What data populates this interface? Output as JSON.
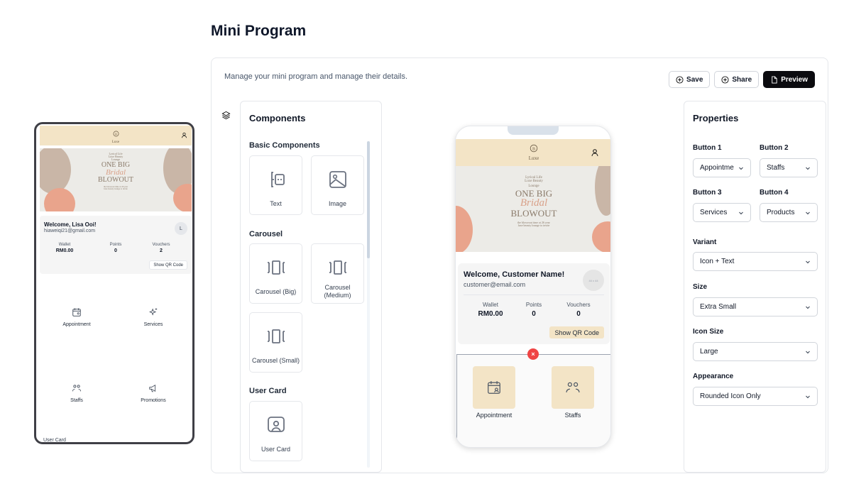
{
  "page": {
    "title": "Mini Program",
    "subtitle": "Manage your mini program and manage their details."
  },
  "toolbar": {
    "save_label": "Save",
    "share_label": "Share",
    "preview_label": "Preview"
  },
  "components": {
    "title": "Components",
    "sections": {
      "basic": "Basic Components",
      "carousel": "Carousel",
      "user_card": "User Card"
    },
    "tiles": {
      "text": "Text",
      "image": "Image",
      "carousel_big": "Carousel (Big)",
      "carousel_medium": "Carousel (Medium)",
      "carousel_small": "Carousel (Small)",
      "user_card": "User Card"
    }
  },
  "preview_phone": {
    "brand": "Luxe",
    "banner": {
      "line1": "Lyrical Life",
      "line2": "Luxe Beauty",
      "line3": "Lounge",
      "headline1": "ONE BIG",
      "script": "Bridal",
      "headline2": "BLOWOUT",
      "fine1": "the bloweout time at 26 year",
      "fine2": "luxe beauty lounge to invite"
    },
    "welcome": "Welcome, Customer Name!",
    "email": "customer@email.com",
    "avatar_text": "44 x 44",
    "stats": [
      {
        "label": "Wallet",
        "value": "RM0.00"
      },
      {
        "label": "Points",
        "value": "0"
      },
      {
        "label": "Vouchers",
        "value": "0"
      }
    ],
    "qr_label": "Show QR Code",
    "close_glyph": "×",
    "quick_buttons": [
      {
        "label": "Appointment",
        "icon": "calendar-user-icon"
      },
      {
        "label": "Staffs",
        "icon": "users-icon"
      }
    ]
  },
  "properties": {
    "title": "Properties",
    "button1": {
      "label": "Button 1",
      "value": "Appointme"
    },
    "button2": {
      "label": "Button 2",
      "value": "Staffs"
    },
    "button3": {
      "label": "Button 3",
      "value": "Services"
    },
    "button4": {
      "label": "Button 4",
      "value": "Products"
    },
    "variant": {
      "label": "Variant",
      "value": "Icon + Text"
    },
    "size": {
      "label": "Size",
      "value": "Extra Small"
    },
    "icon_size": {
      "label": "Icon Size",
      "value": "Large"
    },
    "appearance": {
      "label": "Appearance",
      "value": "Rounded Icon Only"
    }
  },
  "live_phone": {
    "brand": "Luxe",
    "banner": {
      "line1": "Lyrical Life",
      "line2": "Luxe Beauty",
      "line3": "Lounge",
      "headline1": "ONE BIG",
      "script": "Bridal",
      "headline2": "BLOWOUT",
      "fine1": "the bloweout time at 26 year",
      "fine2": "luxe beauty lounge to invite"
    },
    "welcome": "Welcome, Lisa Ooi!",
    "email": "hiaweiqi21@gmail.com",
    "avatar_text": "L",
    "stats": [
      {
        "label": "Wallet",
        "value": "RM0.00"
      },
      {
        "label": "Points",
        "value": "0"
      },
      {
        "label": "Vouchers",
        "value": "2"
      }
    ],
    "qr_label": "Show QR Code",
    "items": [
      {
        "label": "Appointment",
        "icon": "calendar-user-icon"
      },
      {
        "label": "Services",
        "icon": "sparkle-icon"
      },
      {
        "label": "Staffs",
        "icon": "users-icon"
      },
      {
        "label": "Promotions",
        "icon": "megaphone-icon"
      }
    ],
    "tail_label": "User Card"
  },
  "colors": {
    "accent_beige": "#f3e4c6",
    "danger": "#ef4444",
    "primary_dark": "#0b0b0f",
    "banner_peach": "#e9a48c"
  }
}
